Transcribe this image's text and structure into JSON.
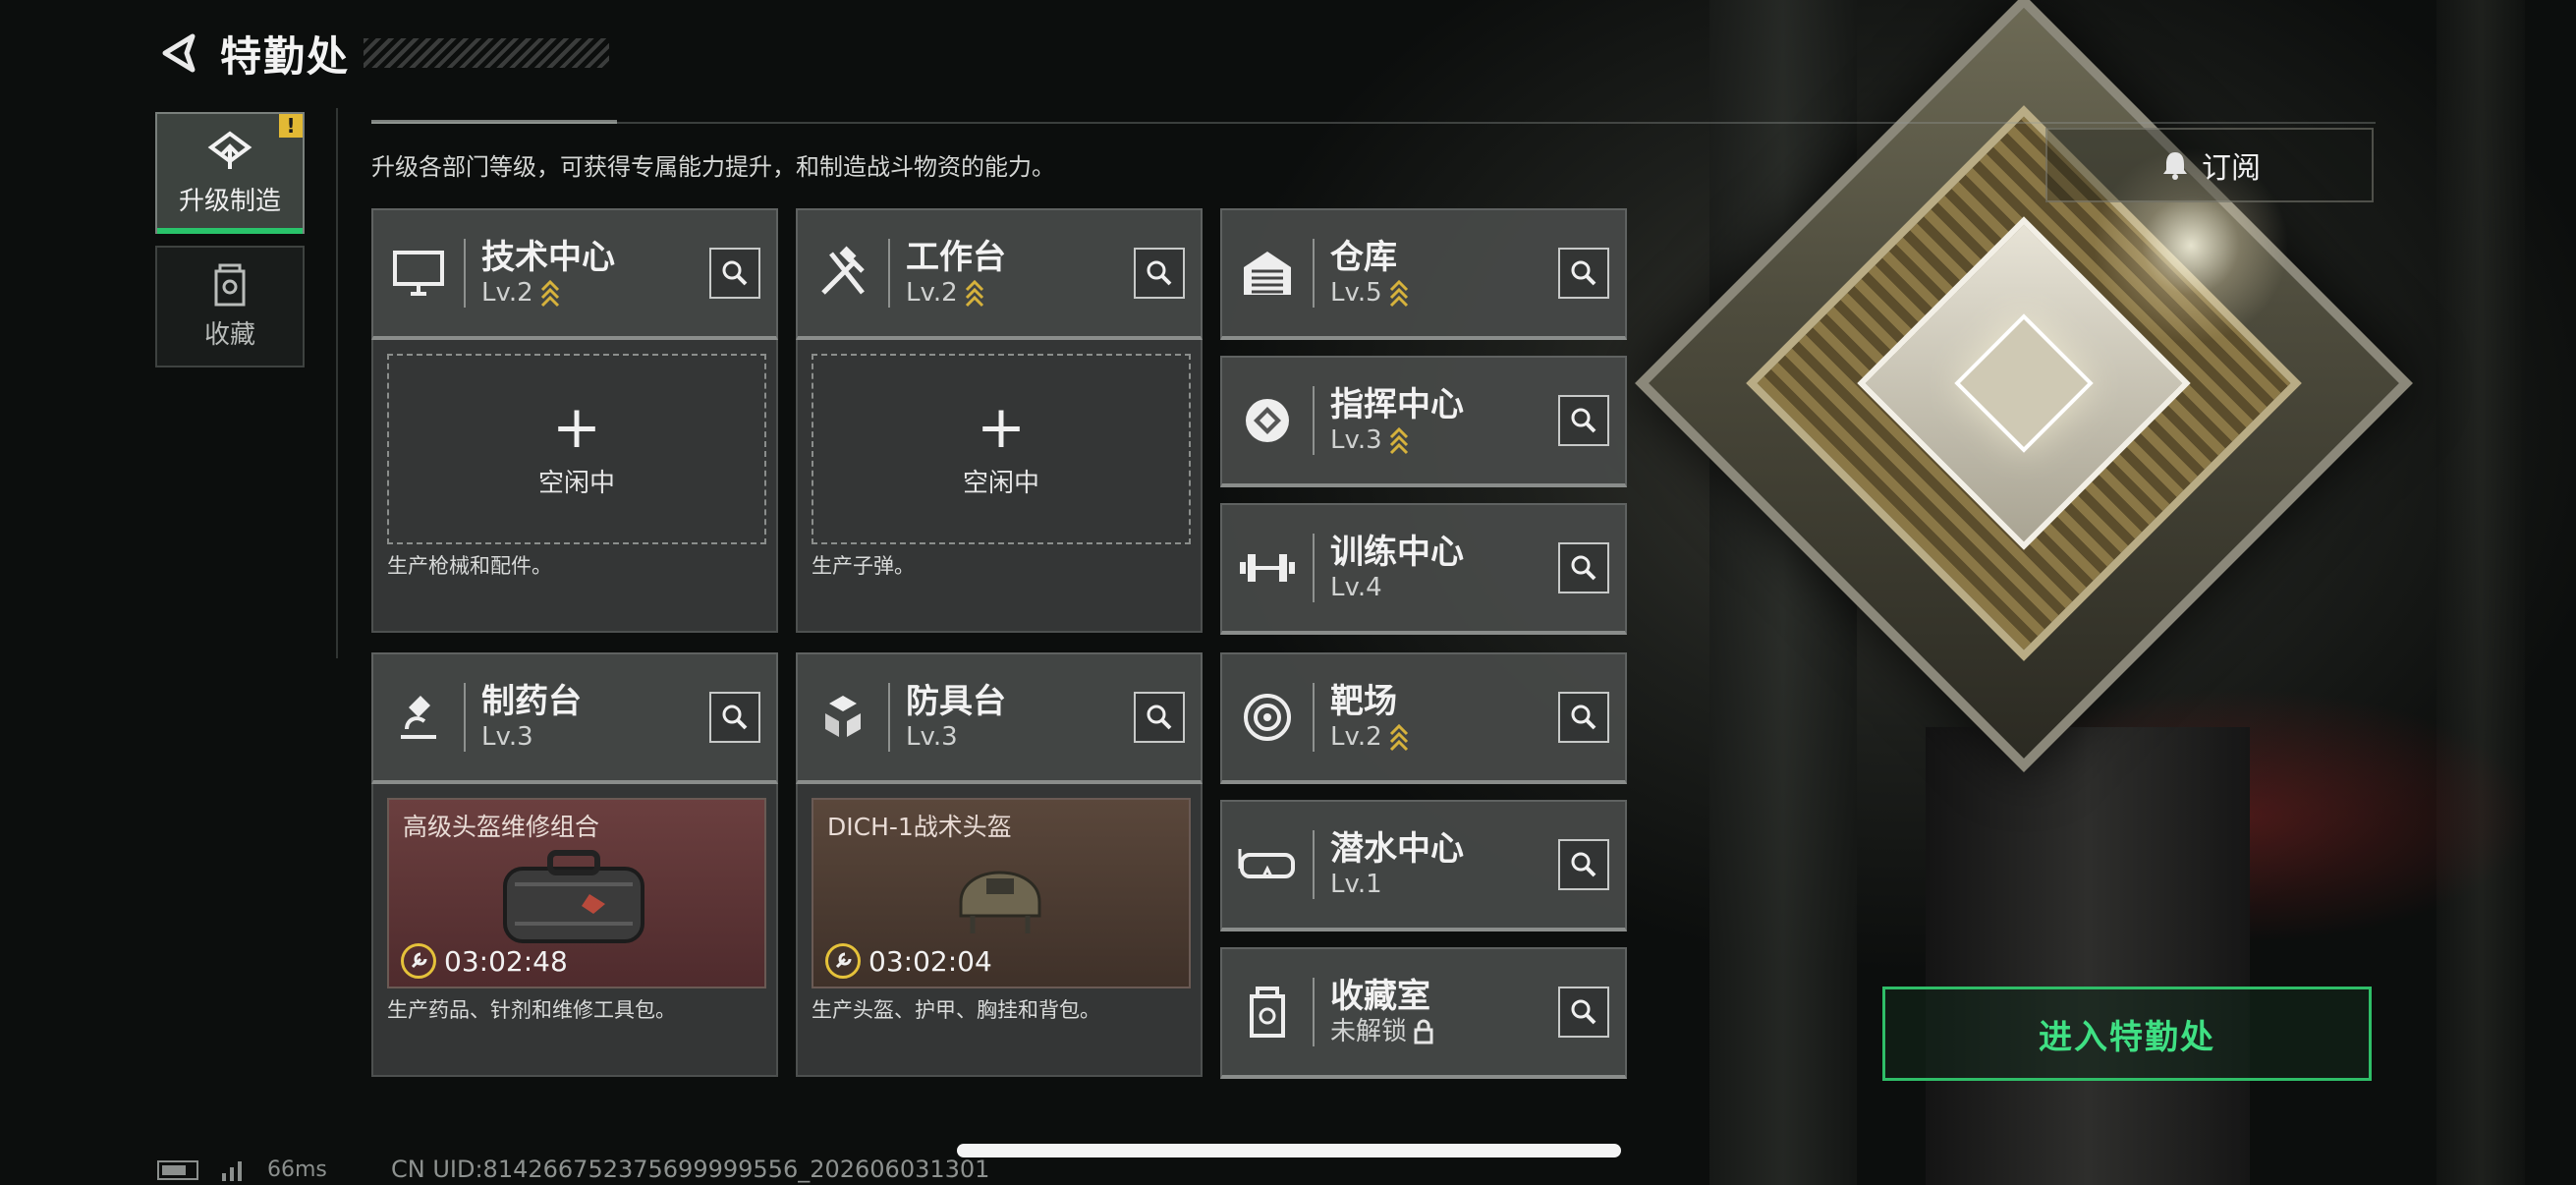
{
  "header": {
    "title": "特勤处"
  },
  "nav": {
    "upgrade": {
      "label": "升级制造",
      "alert": "!"
    },
    "collection": {
      "label": "收藏"
    }
  },
  "description": "升级各部门等级，可获得专属能力提升，和制造战斗物资的能力。",
  "subscribe_label": "订阅",
  "left_grid": {
    "tech_center": {
      "name": "技术中心",
      "level": "Lv.2",
      "slot_label": "空闲中",
      "note": "生产枪械和配件。"
    },
    "workbench": {
      "name": "工作台",
      "level": "Lv.2",
      "slot_label": "空闲中",
      "note": "生产子弹。"
    },
    "pharmacy": {
      "name": "制药台",
      "level": "Lv.3",
      "item_name": "高级头盔维修组合",
      "timer": "03:02:48",
      "note": "生产药品、针剂和维修工具包。"
    },
    "armor_bench": {
      "name": "防具台",
      "level": "Lv.3",
      "item_name": "DICH-1战术头盔",
      "timer": "03:02:04",
      "note": "生产头盔、护甲、胸挂和背包。"
    }
  },
  "right_column": {
    "warehouse": {
      "name": "仓库",
      "level": "Lv.5"
    },
    "command_center": {
      "name": "指挥中心",
      "level": "Lv.3"
    },
    "training_center": {
      "name": "训练中心",
      "level": "Lv.4"
    },
    "shooting_range": {
      "name": "靶场",
      "level": "Lv.2"
    },
    "diving_center": {
      "name": "潜水中心",
      "level": "Lv.1"
    },
    "collection_room": {
      "name": "收藏室",
      "level": "未解锁"
    }
  },
  "enter_button": "进入特勤处",
  "status_bar": {
    "ping": "66ms",
    "uid": "CN UID:814266752375699999556_202606031301"
  },
  "colors": {
    "accent_green": "#2fbe68",
    "upgrade_gold": "#d6b23c",
    "alert_yellow": "#e2b934"
  }
}
